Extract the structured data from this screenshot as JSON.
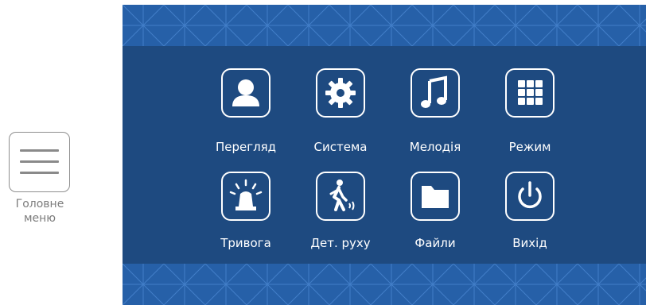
{
  "side_menu": {
    "icon": "hamburger-menu-icon",
    "label_line1": "Головне",
    "label_line2": "меню"
  },
  "screen": {
    "colors": {
      "background": "#1e4a80",
      "band": "#2660a8",
      "pattern": "#4a86d0",
      "foreground": "#ffffff"
    },
    "menu_items": [
      {
        "label": "Перегляд",
        "icon": "person-icon"
      },
      {
        "label": "Система",
        "icon": "gear-icon"
      },
      {
        "label": "Мелодія",
        "icon": "music-note-icon"
      },
      {
        "label": "Режим",
        "icon": "grid-icon"
      },
      {
        "label": "Тривога",
        "icon": "alarm-light-icon"
      },
      {
        "label": "Дет. руху",
        "icon": "motion-detection-icon"
      },
      {
        "label": "Файли",
        "icon": "folder-icon"
      },
      {
        "label": "Вихід",
        "icon": "power-icon"
      }
    ]
  }
}
